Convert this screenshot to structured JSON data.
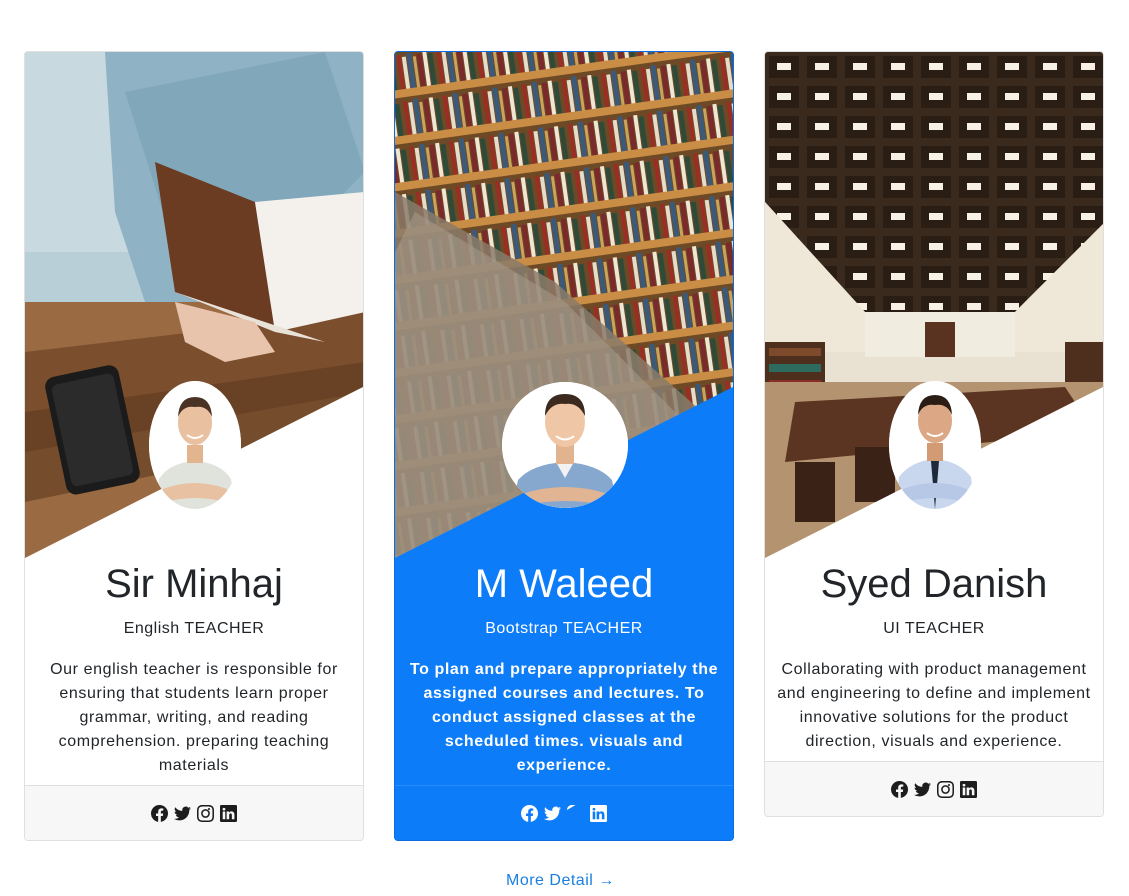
{
  "teachers": [
    {
      "name": "Sir Minhaj",
      "role": "English TEACHER",
      "description": "Our english teacher is responsible for ensuring that students learn proper grammar, writing, and reading comprehension. preparing teaching materials",
      "image": "teacher-reading-book-photo"
    },
    {
      "name": "M Waleed",
      "role": "Bootstrap TEACHER",
      "description": "To plan and prepare appropriately the assigned courses and lectures. To conduct assigned classes at the scheduled times. visuals and experience.",
      "image": "library-bookshelves-photo"
    },
    {
      "name": "Syed Danish",
      "role": "UI TEACHER",
      "description": "Collaborating with product management and engineering to define and implement innovative solutions for the product direction, visuals and experience.",
      "image": "library-hall-photo"
    }
  ],
  "social_icons": [
    "facebook-icon",
    "twitter-icon",
    "instagram-icon",
    "linkedin-icon"
  ],
  "more_link": "More Detail →",
  "colors": {
    "accent": "#0d7cf9",
    "link": "#1a7fe0",
    "footer_bg": "#f7f7f7"
  }
}
